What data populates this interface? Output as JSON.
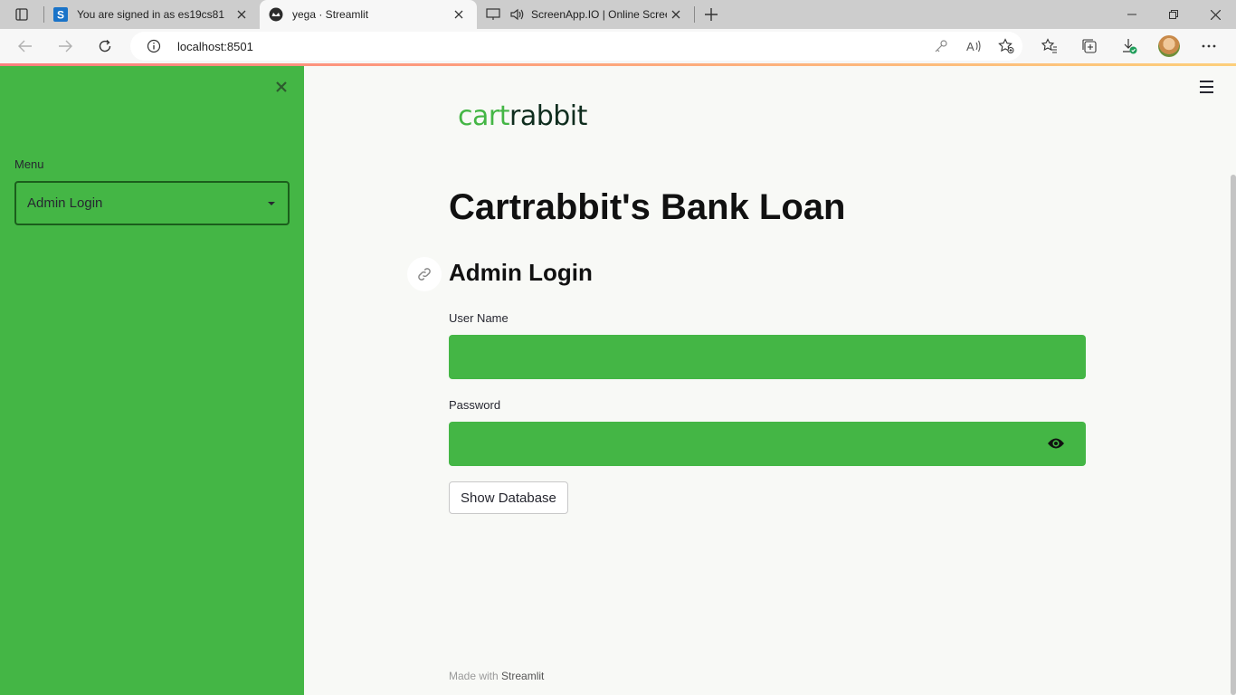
{
  "browser": {
    "tabs": [
      {
        "title": "You are signed in as es19cs81",
        "favicon": "s-logo-icon"
      },
      {
        "title": "yega · Streamlit",
        "favicon": "streamlit-icon"
      },
      {
        "title": "ScreenApp.IO | Online Scree",
        "favicon": "screen-icon"
      }
    ],
    "url": "localhost:8501"
  },
  "sidebar": {
    "menu_label": "Menu",
    "selected": "Admin Login"
  },
  "main": {
    "logo_left": "cart",
    "logo_right": "rabbit",
    "title": "Cartrabbit's Bank Loan",
    "subtitle": "Admin Login",
    "username_label": "User Name",
    "username_value": "",
    "password_label": "Password",
    "password_value": "",
    "button_label": "Show Database",
    "footer_prefix": "Made with ",
    "footer_brand": "Streamlit"
  },
  "colors": {
    "accent": "#44b645",
    "select_border": "#1b5e1c"
  }
}
